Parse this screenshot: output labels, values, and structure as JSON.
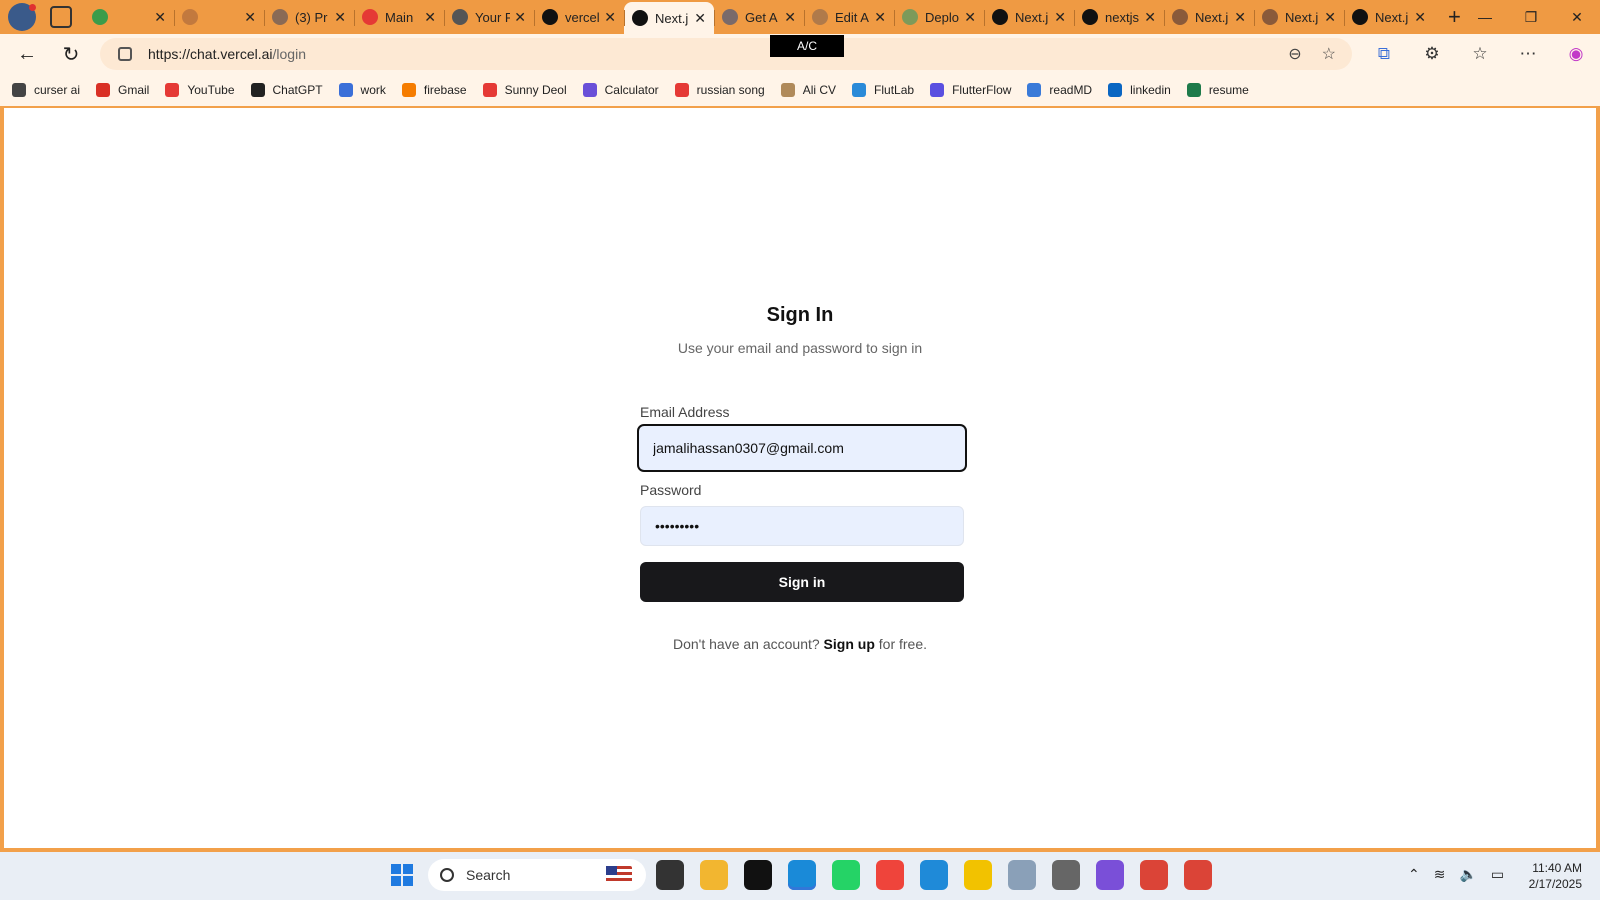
{
  "browser": {
    "tabs": [
      {
        "title": "",
        "favicon": "gfg-icon",
        "color": "#3b9c4a"
      },
      {
        "title": "",
        "favicon": "circle-icon",
        "color": "#c2793e"
      },
      {
        "title": "(3) Pr",
        "favicon": "linkedin-icon",
        "color": "#8a6a55"
      },
      {
        "title": "Main",
        "favicon": "youtube-icon",
        "color": "#e53935"
      },
      {
        "title": "Your F",
        "favicon": "github-icon",
        "color": "#555555"
      },
      {
        "title": "vercel",
        "favicon": "github-icon",
        "color": "#111111"
      },
      {
        "title": "Next.j",
        "favicon": "nextjs-icon",
        "color": "#111111",
        "active": true
      },
      {
        "title": "Get A",
        "favicon": "butterfly-icon",
        "color": "#7a6a6a"
      },
      {
        "title": "Edit A",
        "favicon": "scribble-icon",
        "color": "#b07a4a"
      },
      {
        "title": "Deplo",
        "favicon": "diamond-icon",
        "color": "#7d9a5a"
      },
      {
        "title": "Next.j",
        "favicon": "nextjs-icon",
        "color": "#111111"
      },
      {
        "title": "nextjs",
        "favicon": "vercel-icon",
        "color": "#111111"
      },
      {
        "title": "Next.j",
        "favicon": "nextjs-icon",
        "color": "#8a5a3a"
      },
      {
        "title": "Next.j",
        "favicon": "nextjs-icon",
        "color": "#8a5a3a"
      },
      {
        "title": "Next.j",
        "favicon": "nextjs-icon",
        "color": "#111111"
      }
    ],
    "url_host": "https://chat.vercel.ai",
    "url_path": "/login",
    "tooltip": "A/C"
  },
  "bookmarks": [
    {
      "label": "curser ai",
      "icon": "cursor-icon",
      "color": "#444444"
    },
    {
      "label": "Gmail",
      "icon": "gmail-icon",
      "color": "#d93025"
    },
    {
      "label": "YouTube",
      "icon": "youtube-icon",
      "color": "#e53935"
    },
    {
      "label": "ChatGPT",
      "icon": "openai-icon",
      "color": "#222222"
    },
    {
      "label": "work",
      "icon": "doc-icon",
      "color": "#3b6fd8"
    },
    {
      "label": "firebase",
      "icon": "firebase-icon",
      "color": "#f57c00"
    },
    {
      "label": "Sunny Deol",
      "icon": "youtube-icon",
      "color": "#e53935"
    },
    {
      "label": "Calculator",
      "icon": "calculator-icon",
      "color": "#6a4fd8"
    },
    {
      "label": "russian song",
      "icon": "youtube-icon",
      "color": "#e53935"
    },
    {
      "label": "Ali CV",
      "icon": "cv-icon",
      "color": "#b08a5a"
    },
    {
      "label": "FlutLab",
      "icon": "flutlab-icon",
      "color": "#2a8ad8"
    },
    {
      "label": "FlutterFlow",
      "icon": "flutterflow-icon",
      "color": "#5a4fe0"
    },
    {
      "label": "readMD",
      "icon": "readmd-icon",
      "color": "#3a7ad8"
    },
    {
      "label": "linkedin",
      "icon": "linkedin-icon",
      "color": "#0a66c2"
    },
    {
      "label": "resume",
      "icon": "resume-icon",
      "color": "#1e7a4a"
    }
  ],
  "login": {
    "title": "Sign In",
    "subtitle": "Use your email and password to sign in",
    "email_label": "Email Address",
    "email_value": "jamalihassan0307@gmail.com",
    "password_label": "Password",
    "password_value": "•••••••••",
    "submit_label": "Sign in",
    "signup_prefix": "Don't have an account?",
    "signup_link": "Sign up",
    "signup_suffix": "for free."
  },
  "taskbar": {
    "search_placeholder": "Search",
    "time": "11:40 AM",
    "date": "2/17/2025",
    "apps": [
      {
        "name": "terminal-icon",
        "color": "#333333"
      },
      {
        "name": "file-explorer-icon",
        "color": "#f2b630"
      },
      {
        "name": "capcut-icon",
        "color": "#111111"
      },
      {
        "name": "edge-icon",
        "color": "#1a8ad8",
        "active": true
      },
      {
        "name": "whatsapp-icon",
        "color": "#25d366"
      },
      {
        "name": "anydesk-icon",
        "color": "#ef443b"
      },
      {
        "name": "vscode-icon",
        "color": "#1f8ad8"
      },
      {
        "name": "postman-icon",
        "color": "#f2c200"
      },
      {
        "name": "monitor-icon",
        "color": "#8aa0b8"
      },
      {
        "name": "clock-app-icon",
        "color": "#666666"
      },
      {
        "name": "visual-studio-icon",
        "color": "#7a4fd8"
      },
      {
        "name": "chrome-dev-icon",
        "color": "#db4437"
      },
      {
        "name": "chrome-icon",
        "color": "#db4437"
      }
    ]
  }
}
